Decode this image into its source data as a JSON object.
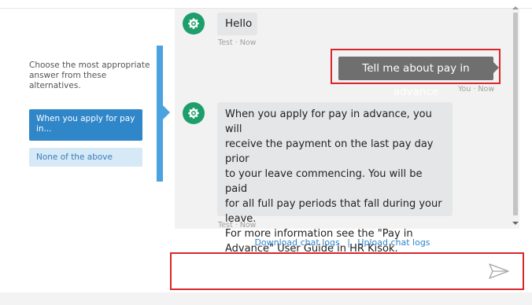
{
  "left_panel": {
    "prompt": "Choose the most appropriate answer from these alternatives.",
    "options": [
      "When you apply for pay in...",
      "None of the above"
    ]
  },
  "messages": {
    "bot_1": {
      "text": "Hello",
      "meta": "Test · Now"
    },
    "user_1": {
      "text": "Tell me about pay in advance",
      "meta": "You · Now"
    },
    "bot_2": {
      "lines": [
        "When you apply for pay in advance, you will",
        "receive the payment on the last pay day prior",
        "to your leave commencing. You will be paid",
        "for all full pay periods that fall during your",
        "leave.",
        "For more information see the \"Pay in",
        "Advance\" User Guide in HR Kisok."
      ],
      "meta": "Test · Now"
    }
  },
  "links": {
    "download": "Download chat logs",
    "separator": "|",
    "upload": "Upload chat logs"
  },
  "input": {
    "value": "",
    "placeholder": ""
  },
  "icons": {
    "bot_avatar": "gear-icon",
    "send": "send-icon"
  },
  "colors": {
    "accent_blue": "#2f86c9",
    "bot_green": "#1e9e6b",
    "highlight_red": "#d9262c",
    "user_bubble": "#6f6f6f"
  }
}
